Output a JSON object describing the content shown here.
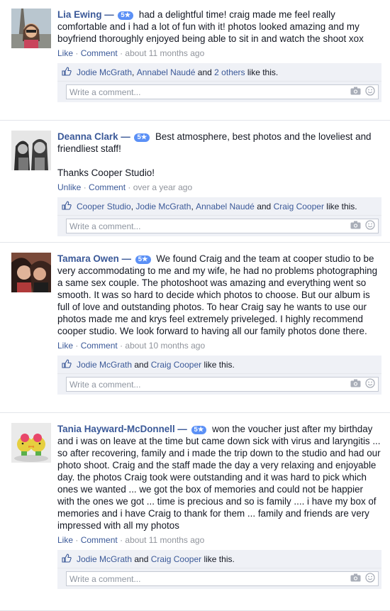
{
  "reviews": [
    {
      "name": "Lia Ewing",
      "rating_badge": "5★",
      "text": "had a delightful time! craig made me feel really comfortable and i had a lot of fun with it! photos looked amazing and my boyfriend thoroughly enjoyed being able to sit in and watch the shoot xox",
      "like_label": "Like",
      "comment_label": "Comment",
      "time": "about 11 months ago",
      "likers": [
        "Jodie McGrath",
        "Annabel Naudé"
      ],
      "likers_more": "2 others",
      "likes_suffix": "like this.",
      "comment_placeholder": "Write a comment..."
    },
    {
      "name": "Deanna Clark",
      "rating_badge": "5★",
      "text": "Best atmosphere, best photos and the loveliest and friendliest staff!",
      "text2": "Thanks Cooper Studio!",
      "like_label": "Unlike",
      "comment_label": "Comment",
      "time": "over a year ago",
      "likers": [
        "Cooper Studio",
        "Jodie McGrath",
        "Annabel Naudé",
        "Craig Cooper"
      ],
      "likes_suffix": "like this.",
      "comment_placeholder": "Write a comment..."
    },
    {
      "name": "Tamara Owen",
      "rating_badge": "5★",
      "text": "We found Craig and the team at cooper studio to be very accommodating to me and my wife, he had no problems photographing a same sex couple. The photoshoot was amazing and everything went so smooth. It was so hard to decide which photos to choose. But our album is full of love and outstanding photos. To hear Craig say he wants to use our photos made me and krys feel extremely priveleged. I highly recommend cooper studio. We look forward to having all our family photos done there.",
      "like_label": "Like",
      "comment_label": "Comment",
      "time": "about 10 months ago",
      "likers": [
        "Jodie McGrath",
        "Craig Cooper"
      ],
      "likes_suffix": "like this.",
      "comment_placeholder": "Write a comment..."
    },
    {
      "name": "Tania Hayward-McDonnell",
      "rating_badge": "5★",
      "text": "won the voucher just after my birthday and i was on leave at the time but came down sick with virus and laryngitis ... so after recovering, family and i made the trip down to the studio and had our photo shoot. Craig and the staff made the day a very relaxing and enjoyable day. the photos Craig took were outstanding and it was hard to pick which ones we wanted ... we got the box of memories and could not be happier with the ones we got ... time is precious and so is family .... i have my box of memories and i have Craig to thank for them ... family and friends are very impressed with all my photos",
      "like_label": "Like",
      "comment_label": "Comment",
      "time": "about 11 months ago",
      "likers": [
        "Jodie McGrath",
        "Craig Cooper"
      ],
      "likes_suffix": "like this.",
      "comment_placeholder": "Write a comment..."
    }
  ],
  "separators": {
    "dash": "—",
    "dot": "·",
    "comma": ",",
    "and": "and"
  },
  "colors": {
    "link": "#3b5998",
    "badge": "#5b90f6",
    "likes_bg": "#eff1f6"
  },
  "icons": [
    "thumbs-up-icon",
    "camera-icon",
    "emoji-icon"
  ]
}
